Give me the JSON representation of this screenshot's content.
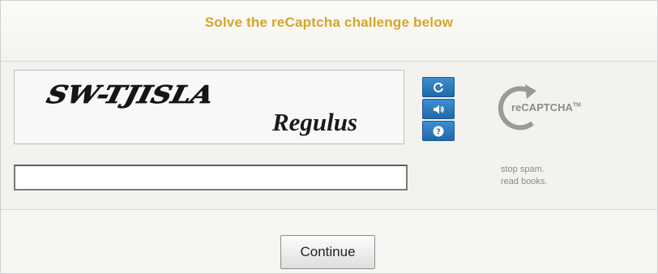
{
  "header": {
    "title": "Solve the reCaptcha challenge below"
  },
  "captcha": {
    "word_1": "SW-TJISLA",
    "word_2": "Regulus",
    "answer_value": "",
    "controls": [
      {
        "icon": "refresh-icon"
      },
      {
        "icon": "audio-icon"
      },
      {
        "icon": "help-icon"
      }
    ]
  },
  "brand": {
    "logo_text": "reCAPTCHA",
    "trademark": "TM",
    "tagline_line_1": "stop spam.",
    "tagline_line_2": "read books."
  },
  "footer": {
    "continue_label": "Continue"
  },
  "colors": {
    "title": "#d4a52a",
    "control_blue": "#2a78bf",
    "brand_gray": "#8c8c8c"
  }
}
